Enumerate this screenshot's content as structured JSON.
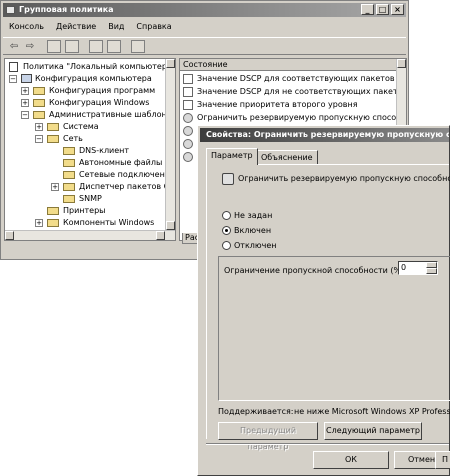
{
  "window": {
    "title": "Групповая политика",
    "controls": [
      "_",
      "□",
      "×"
    ]
  },
  "menu": [
    "Консоль",
    "Действие",
    "Вид",
    "Справка"
  ],
  "toolbar": {
    "icons": [
      "back-arrow-icon",
      "forward-arrow-icon",
      "up-folder-icon",
      "show-hide-tree-icon",
      "properties-icon",
      "export-list-icon",
      "help-icon"
    ],
    "back_glyph": "⇦",
    "forward_glyph": "⇨"
  },
  "tree": {
    "rows": [
      {
        "label": "Политика \"Локальный компьютер\"",
        "expander": "",
        "icon": "doc"
      },
      {
        "label": "Конфигурация компьютера",
        "expander": "−",
        "icon": "pc"
      },
      {
        "label": "Конфигурация программ",
        "expander": "+",
        "icon": "folder"
      },
      {
        "label": "Конфигурация Windows",
        "expander": "+",
        "icon": "folder"
      },
      {
        "label": "Административные шаблоны",
        "expander": "−",
        "icon": "folder"
      },
      {
        "label": "Система",
        "expander": "+",
        "icon": "folder"
      },
      {
        "label": "Сеть",
        "expander": "−",
        "icon": "folder"
      },
      {
        "label": "DNS-клиент",
        "expander": "",
        "icon": "folder"
      },
      {
        "label": "Автономные файлы",
        "expander": "",
        "icon": "folder"
      },
      {
        "label": "Сетевые подключени",
        "expander": "",
        "icon": "folder"
      },
      {
        "label": "Диспетчер пакетов Q",
        "expander": "+",
        "icon": "folder"
      },
      {
        "label": "SNMP",
        "expander": "",
        "icon": "folder"
      },
      {
        "label": "Принтеры",
        "expander": "",
        "icon": "folder"
      },
      {
        "label": "Компоненты Windows",
        "expander": "+",
        "icon": "folder"
      }
    ]
  },
  "list": {
    "header": "Состояние",
    "rows": [
      {
        "label": "Значение DSCP для соответствующих пакетов",
        "icon": "doc"
      },
      {
        "label": "Значение DSCP для не соответствующих пакетов",
        "icon": "doc"
      },
      {
        "label": "Значение приоритета второго уровня",
        "icon": "doc"
      },
      {
        "label": "Ограничить резервируемую пропускную способность",
        "icon": "gear"
      },
      {
        "label": "О",
        "icon": "gear"
      },
      {
        "label": "З",
        "icon": "gear"
      },
      {
        "label": "З",
        "icon": "gear"
      }
    ],
    "bottom_tab": "Рас"
  },
  "dialog": {
    "title": "Свойства: Ограничить резервируемую пропускную способ",
    "tabs": [
      "Параметр",
      "Объяснение"
    ],
    "policy_name": "Ограничить резервируемую пропускную способность",
    "options": [
      {
        "label": "Не задан",
        "selected": false
      },
      {
        "label": "Включен",
        "selected": true
      },
      {
        "label": "Отключен",
        "selected": false
      }
    ],
    "setting_label": "Ограничение пропускной способности (%):",
    "setting_value": "0",
    "supported_label": "Поддерживается:",
    "supported_value": "не ниже Microsoft Windows XP Professional",
    "prev_button": "Предыдущий параметр",
    "next_button": "Следующий параметр",
    "ok_button": "ОК",
    "cancel_button": "Отмена",
    "apply_button": "П"
  }
}
